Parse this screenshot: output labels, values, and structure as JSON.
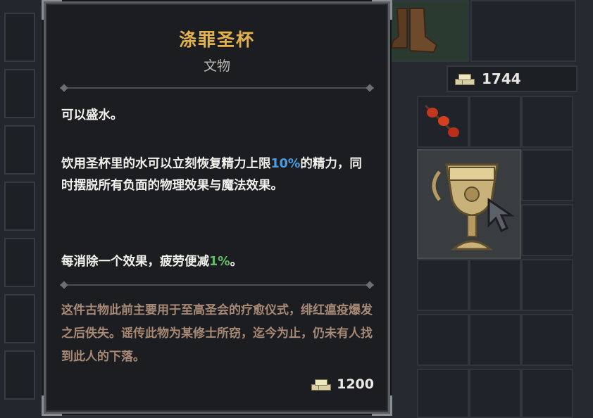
{
  "tooltip": {
    "title": "涤罪圣杯",
    "category": "文物",
    "desc_line1": "可以盛水。",
    "desc2_part1": "饮用圣杯里的水可以立刻恢复精力上限",
    "desc2_highlight": "10%",
    "desc2_part2": "的精力，同时摆脱所有负面的物理效果与魔法效果。",
    "desc3_part1": "每消除一个效果，疲劳便减",
    "desc3_highlight": "1%",
    "desc3_part2": "。",
    "lore": "这件古物此前主要用于至高圣会的疗愈仪式，绯红瘟疫爆发之后佚失。谣传此物为某修士所窃，迄今为止，仍未有人找到此人的下落。",
    "price": "1200",
    "price_icon": "gold-coins-icon"
  },
  "inventory": {
    "gold": "1744",
    "gold_icon": "gold-coins-icon",
    "selected_item_icon": "chalice-icon"
  },
  "colors": {
    "title": "#e3b24a",
    "highlight_blue": "#4c9ee4",
    "highlight_green": "#5fbf64",
    "lore": "#a78975"
  }
}
